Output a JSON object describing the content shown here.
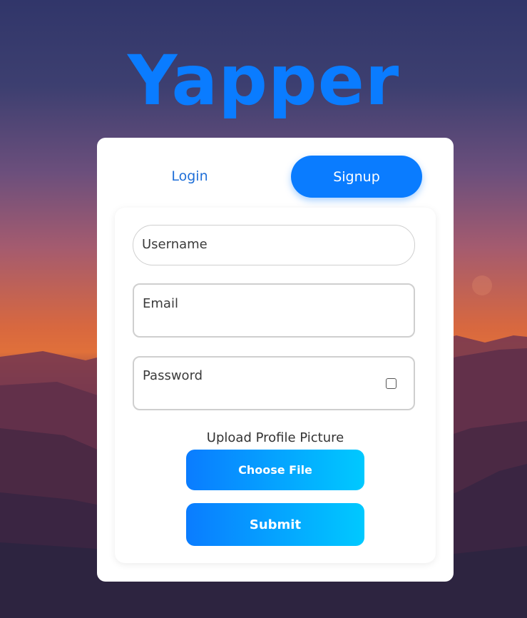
{
  "app": {
    "logo_text": "Yapper"
  },
  "tabs": {
    "login_label": "Login",
    "signup_label": "Signup"
  },
  "form": {
    "username_placeholder": "Username",
    "email_placeholder": "Email",
    "password_placeholder": "Password",
    "upload_label": "Upload Profile Picture",
    "choose_file_label": "Choose File",
    "submit_label": "Submit"
  },
  "colors": {
    "accent": "#0a7cff",
    "gradient_end": "#00c9ff",
    "card_bg": "#ffffff"
  }
}
